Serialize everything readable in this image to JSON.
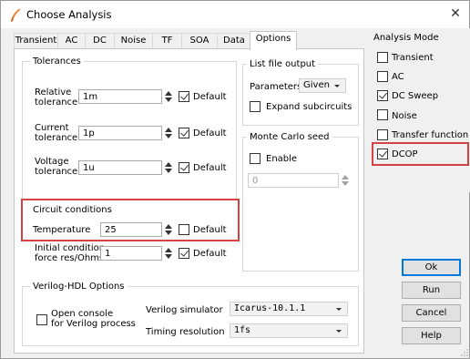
{
  "window": {
    "title": "Choose Analysis",
    "close_glyph": "✕",
    "icon": "feather-pen-icon",
    "accent_color": "#d64343"
  },
  "tabs": [
    {
      "label": "Transient",
      "active": false
    },
    {
      "label": "AC",
      "active": false
    },
    {
      "label": "DC",
      "active": false
    },
    {
      "label": "Noise",
      "active": false
    },
    {
      "label": "TF",
      "active": false
    },
    {
      "label": "SOA",
      "active": false
    },
    {
      "label": "Data",
      "active": false
    },
    {
      "label": "Options",
      "active": true
    }
  ],
  "tolerances": {
    "title": "Tolerances",
    "relative": {
      "label_1": "Relative",
      "label_2": "tolerance",
      "value": "1m",
      "default_label": "Default",
      "default_checked": true
    },
    "current": {
      "label_1": "Current",
      "label_2": "tolerance",
      "value": "1p",
      "default_label": "Default",
      "default_checked": true
    },
    "voltage": {
      "label_1": "Voltage",
      "label_2": "tolerance",
      "value": "1u",
      "default_label": "Default",
      "default_checked": true
    }
  },
  "circuit": {
    "title": "Circuit conditions",
    "temperature": {
      "label": "Temperature",
      "value": "25",
      "default_label": "Default",
      "default_checked": false
    },
    "initial": {
      "label_1": "Initial condition",
      "label_2": "force res/Ohms",
      "value": "1",
      "default_label": "Default",
      "default_checked": true
    }
  },
  "listfile": {
    "title": "List file output",
    "parameters_label": "Parameters",
    "parameters_value": "Given",
    "expand_label": "Expand subcircuits",
    "expand_checked": false
  },
  "montecarlo": {
    "title": "Monte Carlo seed",
    "enable_label": "Enable",
    "enable_checked": false,
    "seed_value": "0"
  },
  "verilog": {
    "title": "Verilog-HDL Options",
    "console_label_1": "Open console",
    "console_label_2": "for Verilog process",
    "console_checked": false,
    "simulator_label": "Verilog simulator",
    "simulator_value": "Icarus-10.1.1",
    "timing_label": "Timing resolution",
    "timing_value": "1fs"
  },
  "analysis_mode": {
    "title": "Analysis Mode",
    "items": [
      {
        "label": "Transient",
        "checked": false
      },
      {
        "label": "AC",
        "checked": false
      },
      {
        "label": "DC Sweep",
        "checked": true
      },
      {
        "label": "Noise",
        "checked": false
      },
      {
        "label": "Transfer function",
        "checked": false
      },
      {
        "label": "DCOP",
        "checked": true
      }
    ]
  },
  "buttons": {
    "ok": "Ok",
    "run": "Run",
    "cancel": "Cancel",
    "help": "Help"
  }
}
